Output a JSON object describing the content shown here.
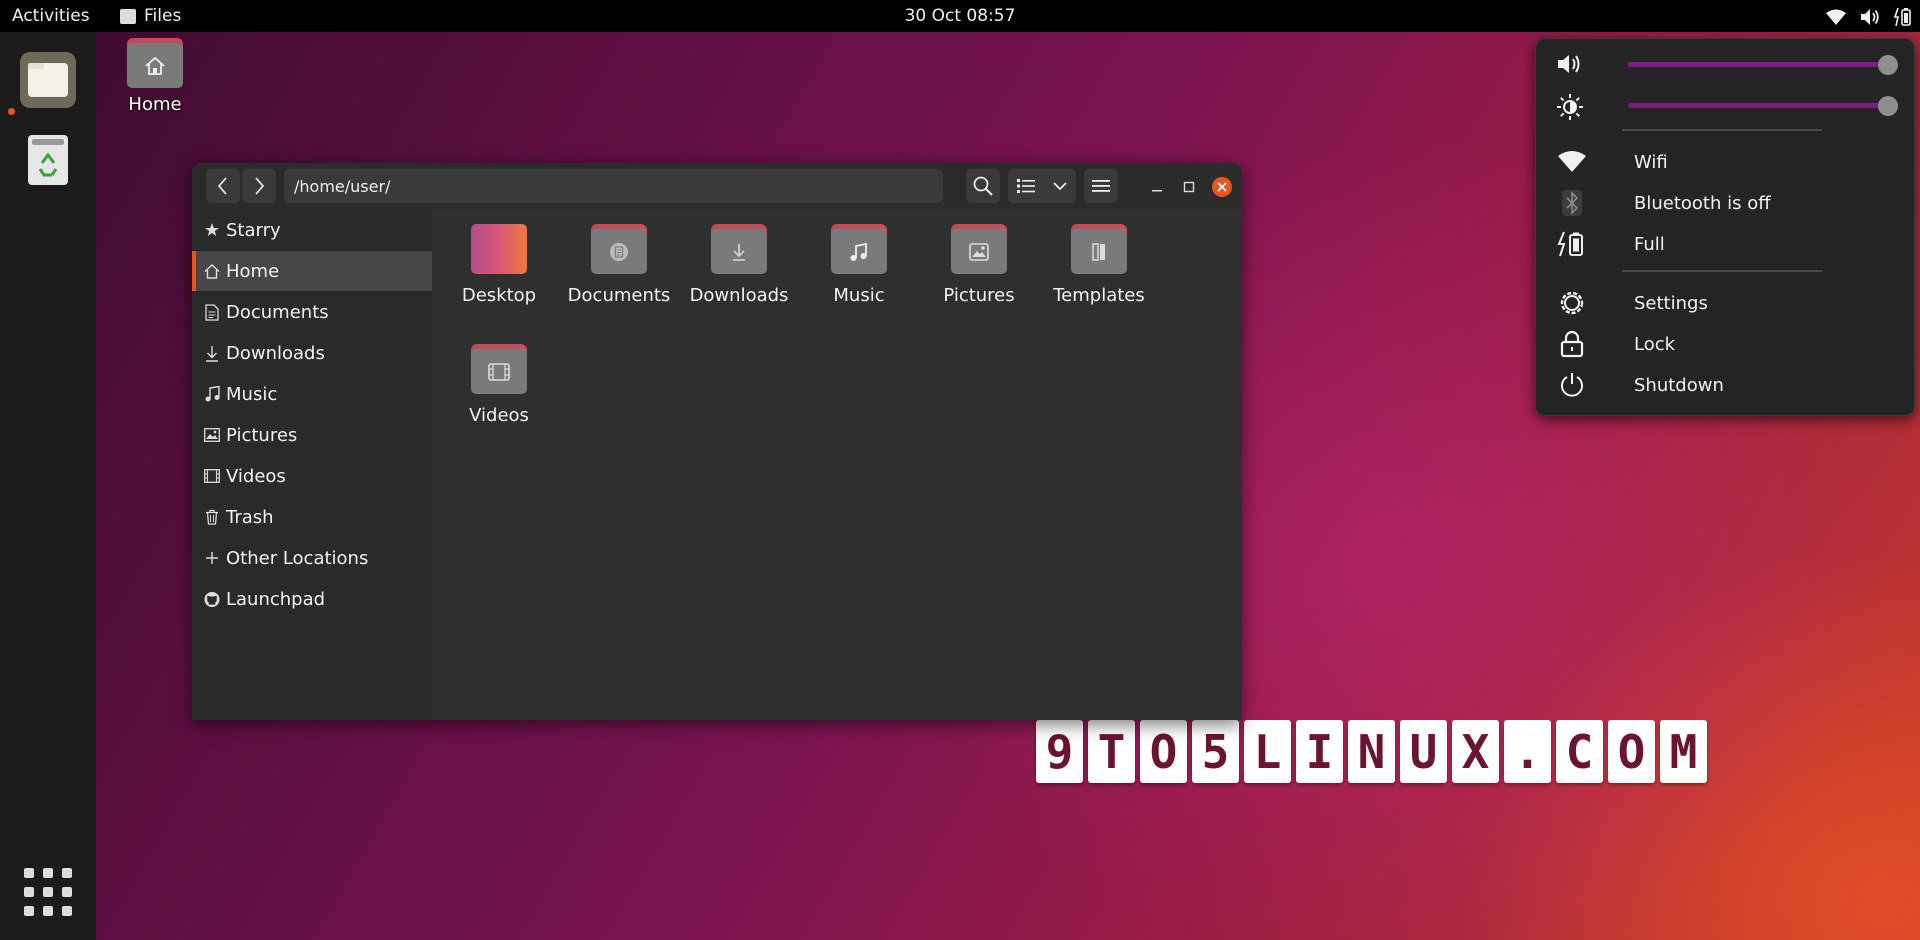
{
  "topbar": {
    "activities": "Activities",
    "app_name": "Files",
    "clock": "30 Oct 08:57"
  },
  "dock": {
    "items": [
      "files",
      "trash"
    ],
    "running_indicator_color": "#e95420"
  },
  "desktop": {
    "home_label": "Home"
  },
  "window": {
    "path": "/home/user/",
    "sidebar": [
      {
        "label": "Starry",
        "icon": "star-icon"
      },
      {
        "label": "Home",
        "icon": "home-icon",
        "active": true
      },
      {
        "label": "Documents",
        "icon": "document-icon"
      },
      {
        "label": "Downloads",
        "icon": "download-icon"
      },
      {
        "label": "Music",
        "icon": "music-note-icon"
      },
      {
        "label": "Pictures",
        "icon": "picture-icon"
      },
      {
        "label": "Videos",
        "icon": "film-icon"
      },
      {
        "label": "Trash",
        "icon": "trash-icon"
      },
      {
        "label": "Other Locations",
        "icon": "plus-icon"
      },
      {
        "label": "Launchpad",
        "icon": "github-icon"
      }
    ],
    "folders": [
      {
        "label": "Desktop"
      },
      {
        "label": "Documents"
      },
      {
        "label": "Downloads"
      },
      {
        "label": "Music"
      },
      {
        "label": "Pictures"
      },
      {
        "label": "Templates"
      },
      {
        "label": "Videos"
      }
    ],
    "accent_color": "#e95420"
  },
  "watermark": {
    "chars": [
      "9",
      "T",
      "O",
      "5",
      "L",
      "I",
      "N",
      "U",
      "X",
      ".",
      "C",
      "O",
      "M"
    ]
  },
  "system_menu": {
    "volume_level": 1.0,
    "brightness_level": 1.0,
    "wifi_label": "Wifi",
    "bluetooth_label": "Bluetooth is off",
    "battery_label": "Full",
    "settings_label": "Settings",
    "lock_label": "Lock",
    "shutdown_label": "Shutdown"
  }
}
